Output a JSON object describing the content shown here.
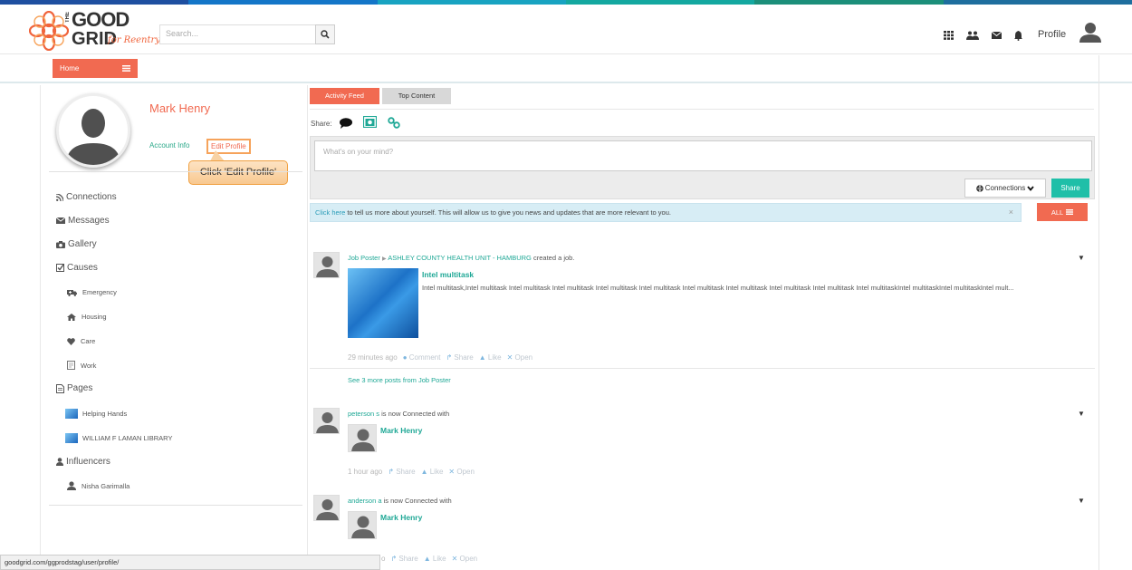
{
  "brand": {
    "the": "THE",
    "line1": "GOOD",
    "line2": "GRID",
    "tagline": "for Reentry",
    "stripe_colors": [
      "#1e4fa0",
      "#1476c8",
      "#18a3c1",
      "#14a8a0",
      "#1c8f7a",
      "#1e6e9e"
    ]
  },
  "header": {
    "search_placeholder": "Search...",
    "profile_label": "Profile",
    "icons": [
      "grid-icon",
      "users-icon",
      "envelope-icon",
      "bell-icon"
    ]
  },
  "nav": {
    "home_label": "Home"
  },
  "profile": {
    "name": "Mark Henry",
    "account_info": "Account Info",
    "edit_profile": "Edit Profile",
    "callout": "Click 'Edit Profile'"
  },
  "sidebar": {
    "items": [
      {
        "label": "Connections",
        "icon": "rss-icon"
      },
      {
        "label": "Messages",
        "icon": "envelope-icon"
      },
      {
        "label": "Gallery",
        "icon": "camera-icon"
      },
      {
        "label": "Causes",
        "icon": "check-square-icon"
      },
      {
        "label": "Emergency",
        "icon": "ambulance-icon"
      },
      {
        "label": "Housing",
        "icon": "home-icon"
      },
      {
        "label": "Care",
        "icon": "heart-icon"
      },
      {
        "label": "Work",
        "icon": "work-icon"
      },
      {
        "label": "Pages",
        "icon": "page-icon"
      },
      {
        "label": "Helping Hands",
        "icon": "page-thumb-icon"
      },
      {
        "label": "WILLIAM F LAMAN LIBRARY",
        "icon": "page-thumb-icon"
      },
      {
        "label": "Influencers",
        "icon": "user-icon"
      },
      {
        "label": "Nisha Garimalla",
        "icon": "user-icon"
      }
    ]
  },
  "feed": {
    "tabs": [
      "Activity Feed",
      "Top Content"
    ],
    "share_label": "Share:",
    "composer_placeholder": "What's on your mind?",
    "connections_label": "Connections",
    "share_button": "Share",
    "info_link": "Click here",
    "info_text": " to tell us more about yourself. This will allow us to give you news and updates that are more relevant to you.",
    "info_close": "×",
    "all_label": "ALL",
    "posts": [
      {
        "actor": "Job Poster",
        "arrow": "▶",
        "target": "ASHLEY COUNTY HEALTH UNIT - HAMBURG",
        "verb": " created a job.",
        "title": "Intel multitask",
        "body": "Intel multitask,Intel multitask Intel multitask Intel multitask Intel multitask Intel multitask Intel multitask Intel multitask Intel multitask Intel multitask  Intel multitaskIntel multitaskIntel multitaskIntel mult...",
        "time": "29 minutes ago",
        "comment": "Comment",
        "share": "Share",
        "like": "Like",
        "open": "Open",
        "more": "See 3 more posts from Job Poster"
      },
      {
        "actor": "peterson s",
        "verb": " is now Connected with",
        "connected": "Mark Henry",
        "time": "1 hour ago",
        "share": "Share",
        "like": "Like",
        "open": "Open"
      },
      {
        "actor": "anderson a",
        "verb": " is now Connected with",
        "connected": "Mark Henry",
        "time": "o",
        "share": "Share",
        "like": "Like",
        "open": "Open"
      }
    ]
  },
  "status_bar": {
    "url": "goodgrid.com/ggprodstag/user/profile/"
  }
}
